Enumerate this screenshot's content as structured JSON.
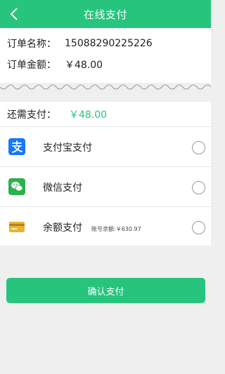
{
  "header": {
    "title": "在线支付",
    "back_icon": "chevron-left-icon",
    "color": "#27c47d"
  },
  "order": {
    "name_label": "订单名称：",
    "name_value": "15088290225226",
    "amount_label": "订单金额：",
    "amount_value": "￥48.00"
  },
  "payment": {
    "remaining_label": "还需支付：",
    "remaining_value": "￥48.00",
    "methods": [
      {
        "name": "支付宝支付",
        "icon": "alipay-icon",
        "color": "#1677ff",
        "selected": false
      },
      {
        "name": "微信支付",
        "icon": "wechat-icon",
        "color": "#2bb24c",
        "selected": false
      },
      {
        "name": "余额支付",
        "icon": "balance-card-icon",
        "color": "#e8b530",
        "balance_text": "账号余额:￥630.97",
        "selected": false
      }
    ]
  },
  "confirm_label": "确认支付"
}
